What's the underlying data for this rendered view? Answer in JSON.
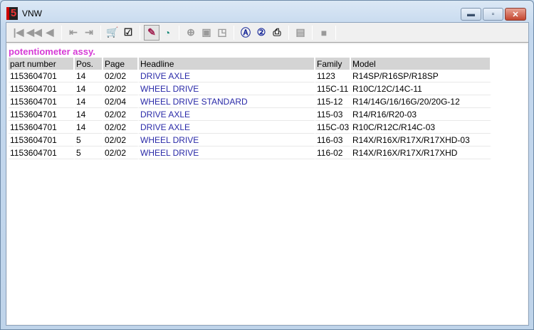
{
  "window": {
    "title": "VNW",
    "logo": "5"
  },
  "toolbar": {
    "buttons": [
      {
        "name": "first-icon",
        "glyph": "|◀",
        "enabled": false
      },
      {
        "name": "rewind-icon",
        "glyph": "◀◀",
        "enabled": false
      },
      {
        "name": "previous-icon",
        "glyph": "◀",
        "enabled": false
      },
      {
        "name": "back-doc-icon",
        "glyph": "⇤",
        "enabled": false
      },
      {
        "name": "forward-doc-icon",
        "glyph": "⇥",
        "enabled": false
      },
      {
        "name": "cart-icon",
        "glyph": "🛒",
        "enabled": true
      },
      {
        "name": "checklist-icon",
        "glyph": "☑",
        "enabled": true
      },
      {
        "name": "pin-icon",
        "glyph": "✎",
        "enabled": true,
        "pressed": true
      },
      {
        "name": "clock-icon",
        "glyph": "◔",
        "enabled": true
      },
      {
        "name": "zoom-in-icon",
        "glyph": "⊕",
        "enabled": false
      },
      {
        "name": "page-icon",
        "glyph": "▣",
        "enabled": false
      },
      {
        "name": "page-fit-icon",
        "glyph": "◳",
        "enabled": false
      },
      {
        "name": "search-a-icon",
        "glyph": "Ⓐ",
        "enabled": true
      },
      {
        "name": "search-2-icon",
        "glyph": "②",
        "enabled": true
      },
      {
        "name": "print-icon",
        "glyph": "⎙",
        "enabled": true
      },
      {
        "name": "notes-icon",
        "glyph": "▤",
        "enabled": false
      },
      {
        "name": "stop-icon",
        "glyph": "■",
        "enabled": false
      }
    ]
  },
  "heading": "potentiometer assy.",
  "table": {
    "headers": [
      "part number",
      "Pos.",
      "Page",
      "Headline",
      "Family",
      "Model"
    ],
    "rows": [
      [
        "1153604701",
        "14",
        "02/02",
        "DRIVE AXLE",
        "1123",
        "R14SP/R16SP/R18SP"
      ],
      [
        "1153604701",
        "14",
        "02/02",
        "WHEEL DRIVE",
        "115C-11",
        "R10C/12C/14C-11"
      ],
      [
        "1153604701",
        "14",
        "02/04",
        "WHEEL DRIVE STANDARD",
        "115-12",
        "R14/14G/16/16G/20/20G-12"
      ],
      [
        "1153604701",
        "14",
        "02/02",
        "DRIVE AXLE",
        "115-03",
        "R14/R16/R20-03"
      ],
      [
        "1153604701",
        "14",
        "02/02",
        "DRIVE AXLE",
        "115C-03",
        "R10C/R12C/R14C-03"
      ],
      [
        "1153604701",
        "5",
        "02/02",
        "WHEEL DRIVE",
        "116-03",
        "R14X/R16X/R17X/R17XHD-03"
      ],
      [
        "1153604701",
        "5",
        "02/02",
        "WHEEL DRIVE",
        "116-02",
        "R14X/R16X/R17X/R17XHD"
      ]
    ]
  }
}
